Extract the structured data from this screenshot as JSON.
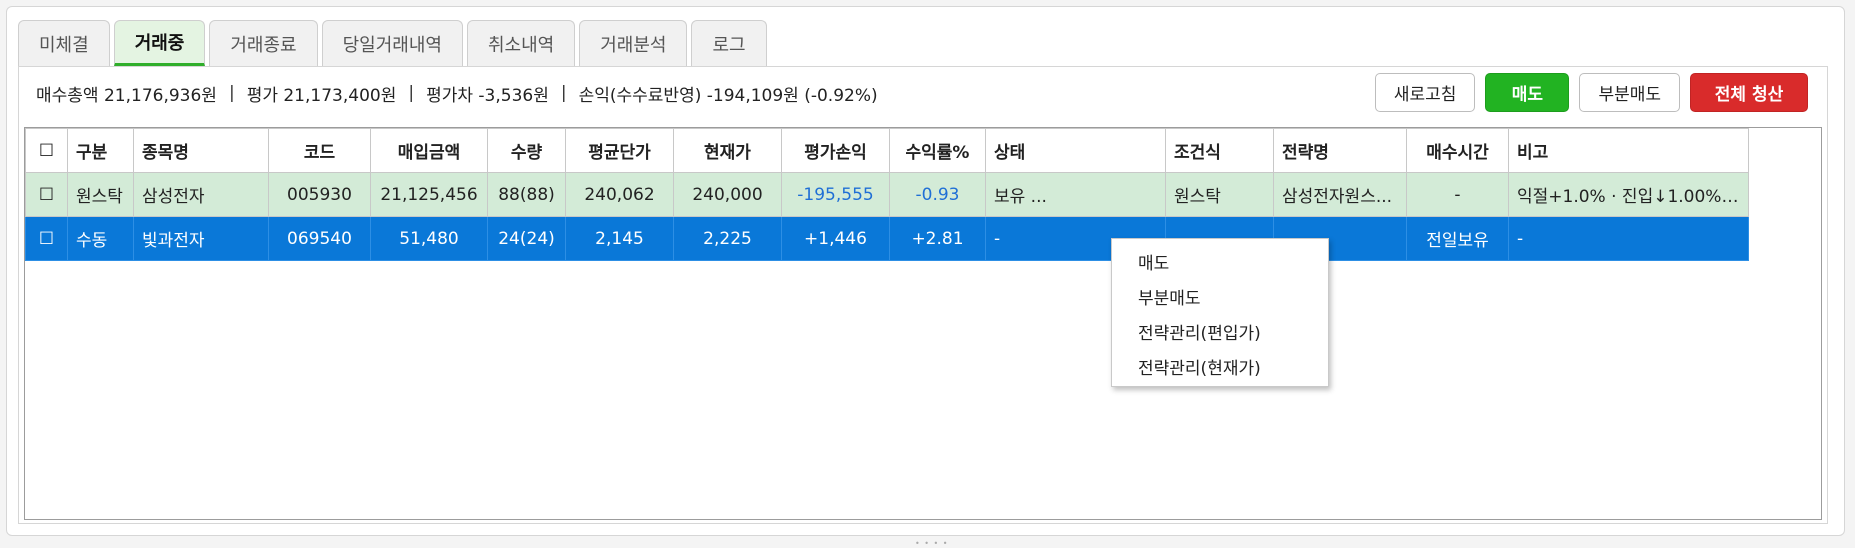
{
  "tabs": [
    {
      "label": "미체결",
      "active": false
    },
    {
      "label": "거래중",
      "active": true
    },
    {
      "label": "거래종료",
      "active": false
    },
    {
      "label": "당일거래내역",
      "active": false
    },
    {
      "label": "취소내역",
      "active": false
    },
    {
      "label": "거래분석",
      "active": false
    },
    {
      "label": "로그",
      "active": false
    }
  ],
  "summary": {
    "buy_total": "매수총액 21,176,936원",
    "valuation": "평가 21,173,400원",
    "valuation_diff": "평가차 -3,536원",
    "pnl": "손익(수수료반영) -194,109원 (-0.92%)",
    "separator": "|"
  },
  "buttons": {
    "refresh": "새로고침",
    "sell": "매도",
    "partial_sell": "부분매도",
    "liquidate_all": "전체 청산"
  },
  "table": {
    "columns": [
      "☐",
      "구분",
      "종목명",
      "코드",
      "매입금액",
      "수량",
      "평균단가",
      "현재가",
      "평가손익",
      "수익률%",
      "상태",
      "조건식",
      "전략명",
      "매수시간",
      "비고"
    ],
    "rows": [
      {
        "checkbox": "☐",
        "type": "원스탁",
        "name": "삼성전자",
        "code": "005930",
        "buy_amount": "21,125,456",
        "qty": "88(88)",
        "avg_price": "240,062",
        "current_price": "240,000",
        "eval_pnl": "-195,555",
        "return_pct": "-0.93",
        "status": "보유 ...",
        "condition": "원스탁",
        "strategy": "삼성전자원스...",
        "buy_time": "-",
        "note": "익절+1.0% · 진입↓1.00% ·..."
      },
      {
        "checkbox": "☐",
        "type": "수동",
        "name": "빛과전자",
        "code": "069540",
        "buy_amount": "51,480",
        "qty": "24(24)",
        "avg_price": "2,145",
        "current_price": "2,225",
        "eval_pnl": "+1,446",
        "return_pct": "+2.81",
        "status": "-",
        "condition": "",
        "strategy": "",
        "buy_time": "전일보유",
        "note": "-"
      }
    ]
  },
  "context_menu": [
    "매도",
    "부분매도",
    "전략관리(편입가)",
    "전략관리(현재가)"
  ],
  "colors": {
    "accent_green": "#22b322",
    "danger_red": "#d92b2b",
    "selected_row": "#0a78d8",
    "holding_row": "#d3ebd7",
    "negative_text": "#1f6fd6"
  }
}
